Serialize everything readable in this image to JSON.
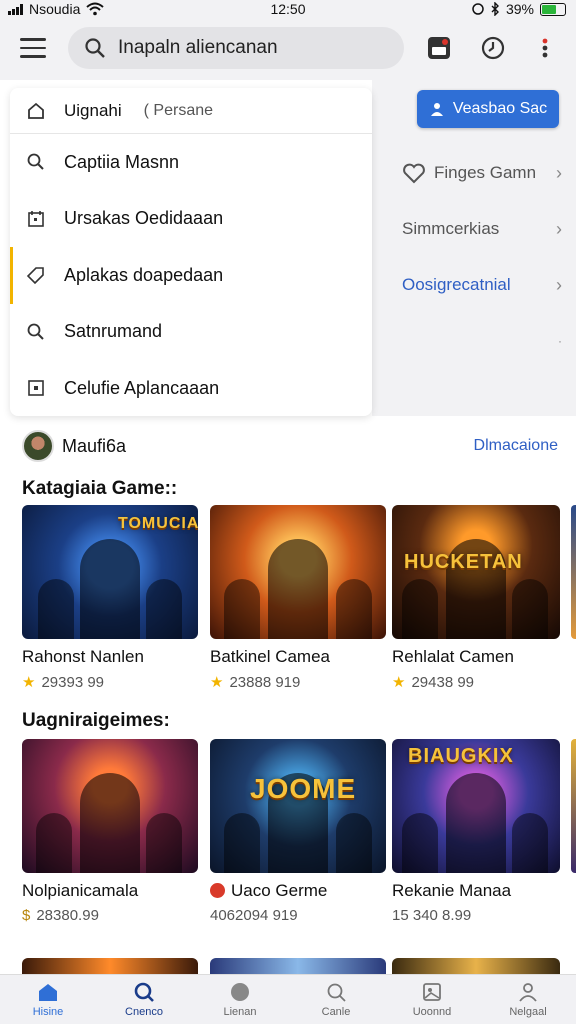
{
  "status_bar": {
    "carrier": "Nsoudia",
    "time": "12:50",
    "battery": "39%"
  },
  "search": {
    "placeholder": "Inapaln aliencanan"
  },
  "dropdown": {
    "header": {
      "title": "Uignahi",
      "subtitle": "( Persane"
    },
    "items": [
      {
        "label": "Captiia Masnn",
        "icon": "search-icon"
      },
      {
        "label": "Ursakas Oedidaaan",
        "icon": "calendar-icon"
      },
      {
        "label": "Aplakas doapedaan",
        "icon": "tag-icon"
      },
      {
        "label": "Satnrumand",
        "icon": "search-icon"
      },
      {
        "label": "Celufie Aplancaaan",
        "icon": "square-icon"
      }
    ]
  },
  "right_panel": {
    "primary_button": "Veasbao Sac",
    "rows": [
      {
        "label": "Finges Gamn",
        "icon": "heart-icon"
      },
      {
        "label": "Simmcerkias"
      },
      {
        "label": "Oosigrecatnial"
      }
    ]
  },
  "user": {
    "name": "Maufi6a",
    "link": "Dlmacaione"
  },
  "sections": [
    {
      "title": "Katagiaia Game::",
      "cards": [
        {
          "name": "Rahonst Nanlen",
          "meta": "29393 99",
          "badge": "star",
          "art_title": "TOMUCIA"
        },
        {
          "name": "Batkinel Camea",
          "meta": "23888 919",
          "badge": "star",
          "art_title": ""
        },
        {
          "name": "Rehlalat Camen",
          "meta": "29438 99",
          "badge": "star",
          "art_title": "HUCKETAN"
        }
      ]
    },
    {
      "title": "Uagniraigeimes:",
      "cards": [
        {
          "name": "Nolpianicamala",
          "meta": "28380.99",
          "badge": "currency",
          "art_title": ""
        },
        {
          "name": "Uaco Germe",
          "meta": "4062094 919",
          "badge": "reddot",
          "art_title": "JOOME"
        },
        {
          "name": "Rekanie Manaa",
          "meta": "15 340 8.99",
          "badge": "none",
          "art_title": "BIAUGKIX"
        }
      ]
    }
  ],
  "bottom_nav": [
    {
      "label": "Hisine",
      "icon": "home-icon",
      "state": "active"
    },
    {
      "label": "Cnenco",
      "icon": "search-icon",
      "state": "active-dark"
    },
    {
      "label": "Lienan",
      "icon": "circle-icon",
      "state": ""
    },
    {
      "label": "Canle",
      "icon": "search-icon",
      "state": ""
    },
    {
      "label": "Uoonnd",
      "icon": "gallery-icon",
      "state": ""
    },
    {
      "label": "Nelgaal",
      "icon": "profile-icon",
      "state": ""
    }
  ],
  "colors": {
    "accent": "#2f6fd6",
    "star": "#f2b400",
    "link": "#2f5fc4"
  }
}
